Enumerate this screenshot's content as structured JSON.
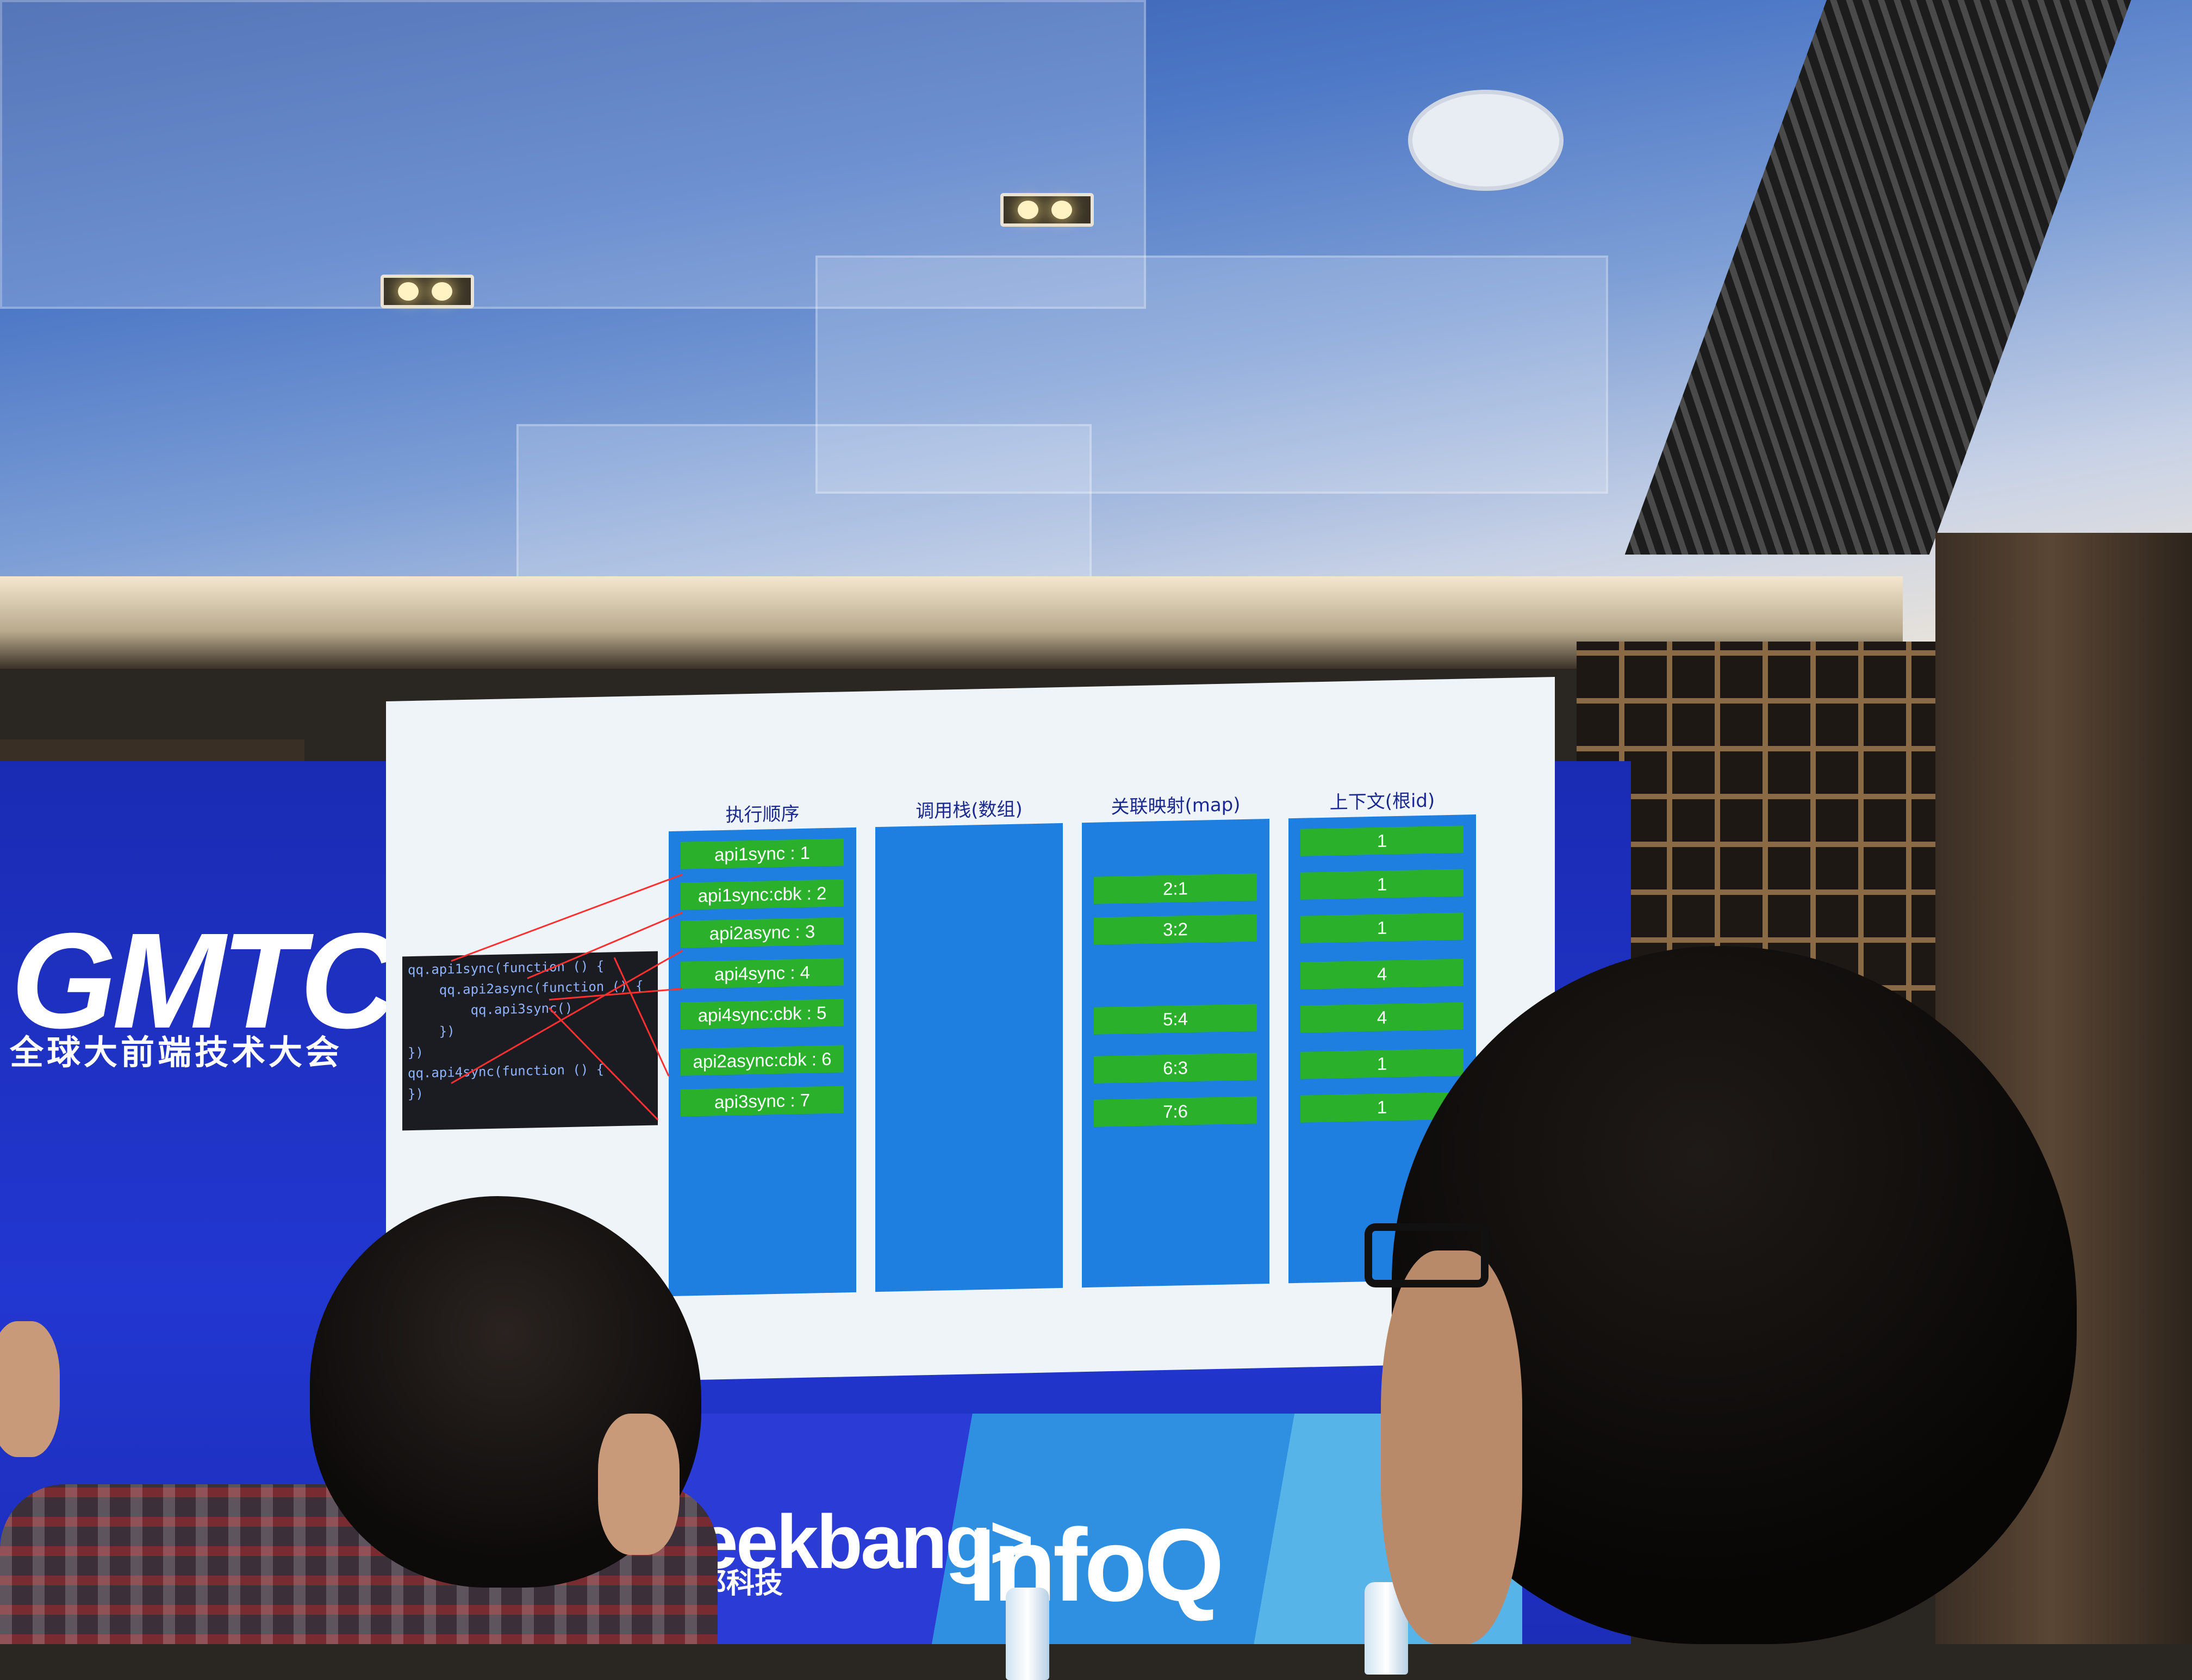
{
  "backdrop": {
    "logo": "GMTC",
    "subtitle": "全球大前端技术大会",
    "brand_geek": "Geekbang>.",
    "brand_geek_cn": "极客邦科技",
    "brand_infoq": "InfoQ"
  },
  "slide": {
    "code_lines": [
      "qq.api1sync(function () {",
      "    qq.api2async(function () {",
      "        qq.api3sync()",
      "    })",
      "})",
      "qq.api4sync(function () {",
      "",
      "})"
    ],
    "columns": [
      {
        "title": "执行顺序",
        "items": [
          "api1sync : 1",
          "api1sync:cbk : 2",
          "api2async : 3",
          "api4sync : 4",
          "api4sync:cbk : 5",
          "api2async:cbk : 6",
          "api3sync : 7"
        ]
      },
      {
        "title": "调用栈(数组)",
        "items": []
      },
      {
        "title": "关联映射(map)",
        "items": [
          "2:1",
          "3:2",
          "5:4",
          "6:3",
          "7:6"
        ]
      },
      {
        "title": "上下文(根id)",
        "items": [
          "1",
          "1",
          "1",
          "4",
          "4",
          "1",
          "1"
        ]
      }
    ]
  },
  "colors": {
    "backdrop_blue": "#2237d1",
    "column_blue": "#1f7fe0",
    "item_green": "#2bb02b"
  }
}
